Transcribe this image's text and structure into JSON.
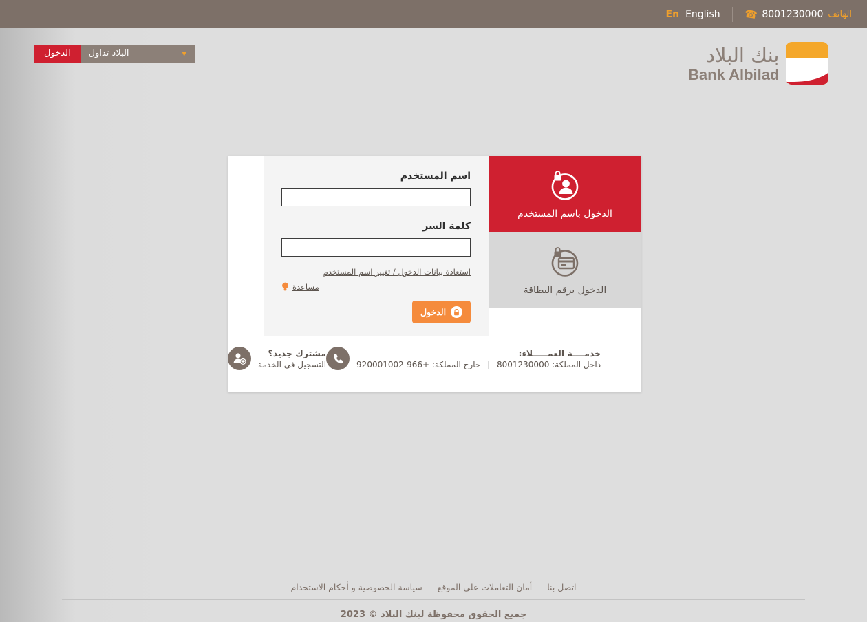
{
  "topbar": {
    "phone_label": "الهاتف",
    "phone_number": "8001230000",
    "phone_icon": "phone-icon",
    "lang_label": "English",
    "lang_short": "En"
  },
  "header": {
    "login_button": "الدخول",
    "trade_dropdown": "البلاد تداول",
    "logo_ar": "بنك البلاد",
    "logo_en": "Bank Albilad"
  },
  "tabs": [
    {
      "label": "الدخول باسم المستخدم",
      "icon": "user-lock-icon",
      "active": true
    },
    {
      "label": "الدخول برقم البطاقة",
      "icon": "card-lock-icon",
      "active": false
    }
  ],
  "form": {
    "username_label": "اسم المستخدم",
    "username_value": "",
    "username_placeholder": "",
    "password_label": "كلمة السر",
    "password_value": "",
    "password_placeholder": "",
    "recover_link": "استعادة بيانات الدخول / تغيير اسم المستخدم",
    "help_link": "مساعدة",
    "help_icon": "lightbulb-icon",
    "submit_label": "الدخول",
    "submit_icon": "lock-icon"
  },
  "card_footer": {
    "new_user_title": "مشترك جديد؟",
    "new_user_sub": "التسجيل في الخدمة",
    "new_user_icon": "add-user-icon",
    "service_title": "خدمــــة العمـــــلاء:",
    "service_icon": "phone-circle-icon",
    "inside_label": "داخل المملكة:",
    "inside_number": "8001230000",
    "outside_label": "خارج المملكة:",
    "outside_number": "+966-920001002",
    "separator": "|"
  },
  "footer": {
    "links": [
      "سياسة الخصوصية و أحكام الاستخدام",
      "أمان التعاملات على الموقع",
      "اتصل بنا"
    ],
    "copyright": "جميع الحقوق محفوظة لبنك البلاد © 2023"
  },
  "colors": {
    "brand_red": "#cf2030",
    "brand_orange": "#f4a72a",
    "taupe": "#7d7068",
    "button_orange": "#f58b3c",
    "page_bg": "#dedede"
  }
}
